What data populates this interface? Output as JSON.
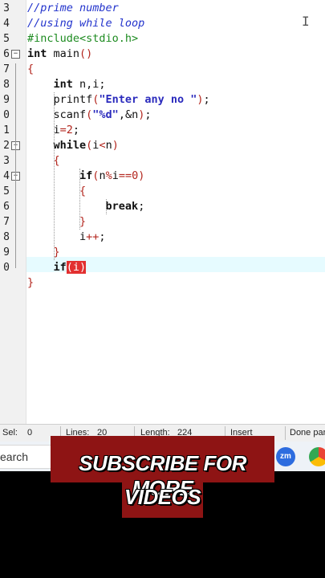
{
  "editor": {
    "line_numbers": [
      "3",
      "4",
      "5",
      "6",
      "7",
      "8",
      "9",
      "0",
      "1",
      "2",
      "3",
      "4",
      "5",
      "6",
      "7",
      "8",
      "9",
      "0"
    ],
    "lines": [
      [
        {
          "c": "cmt",
          "t": "//prime number"
        }
      ],
      [
        {
          "c": "cmt",
          "t": "//using while loop"
        }
      ],
      [
        {
          "c": "pre",
          "t": "#include<stdio.h>"
        }
      ],
      [
        {
          "c": "kw",
          "t": "int"
        },
        {
          "c": "nm",
          "t": " main"
        },
        {
          "c": "br",
          "t": "()"
        }
      ],
      [
        {
          "c": "br",
          "t": "{"
        }
      ],
      [
        {
          "c": "nm",
          "t": "    "
        },
        {
          "c": "kw",
          "t": "int"
        },
        {
          "c": "nm",
          "t": " n,i;"
        }
      ],
      [
        {
          "c": "nm",
          "t": "    printf"
        },
        {
          "c": "br",
          "t": "("
        },
        {
          "c": "str",
          "t": "\"Enter any no \""
        },
        {
          "c": "br",
          "t": ")"
        },
        {
          "c": "nm",
          "t": ";"
        }
      ],
      [
        {
          "c": "nm",
          "t": "    scanf"
        },
        {
          "c": "br",
          "t": "("
        },
        {
          "c": "str",
          "t": "\"%d\""
        },
        {
          "c": "nm",
          "t": ",&n"
        },
        {
          "c": "br",
          "t": ")"
        },
        {
          "c": "nm",
          "t": ";"
        }
      ],
      [
        {
          "c": "nm",
          "t": "    i"
        },
        {
          "c": "op",
          "t": "="
        },
        {
          "c": "num",
          "t": "2"
        },
        {
          "c": "nm",
          "t": ";"
        }
      ],
      [
        {
          "c": "nm",
          "t": "    "
        },
        {
          "c": "kw",
          "t": "while"
        },
        {
          "c": "br",
          "t": "("
        },
        {
          "c": "nm",
          "t": "i"
        },
        {
          "c": "op",
          "t": "<"
        },
        {
          "c": "nm",
          "t": "n"
        },
        {
          "c": "br",
          "t": ")"
        }
      ],
      [
        {
          "c": "nm",
          "t": "    "
        },
        {
          "c": "br",
          "t": "{"
        }
      ],
      [
        {
          "c": "nm",
          "t": "        "
        },
        {
          "c": "kw",
          "t": "if"
        },
        {
          "c": "br",
          "t": "("
        },
        {
          "c": "nm",
          "t": "n"
        },
        {
          "c": "op",
          "t": "%"
        },
        {
          "c": "nm",
          "t": "i"
        },
        {
          "c": "op",
          "t": "=="
        },
        {
          "c": "num",
          "t": "0"
        },
        {
          "c": "br",
          "t": ")"
        }
      ],
      [
        {
          "c": "nm",
          "t": "        "
        },
        {
          "c": "br",
          "t": "{"
        }
      ],
      [
        {
          "c": "nm",
          "t": "            "
        },
        {
          "c": "kw",
          "t": "break"
        },
        {
          "c": "nm",
          "t": ";"
        }
      ],
      [
        {
          "c": "nm",
          "t": "        "
        },
        {
          "c": "br",
          "t": "}"
        }
      ],
      [
        {
          "c": "nm",
          "t": "        i"
        },
        {
          "c": "op",
          "t": "++"
        },
        {
          "c": "nm",
          "t": ";"
        }
      ],
      [
        {
          "c": "nm",
          "t": "    "
        },
        {
          "c": "br",
          "t": "}"
        }
      ],
      [
        {
          "c": "nm",
          "t": "    "
        },
        {
          "c": "kw",
          "t": "if"
        },
        {
          "c": "hl",
          "t": "(i)"
        }
      ],
      [
        {
          "c": "br",
          "t": "}"
        }
      ]
    ]
  },
  "status": {
    "sel_label": "Sel:",
    "sel_value": "0",
    "lines_label": "Lines:",
    "lines_value": "20",
    "length_label": "Length:",
    "length_value": "224",
    "mode": "Insert",
    "state": "Done par"
  },
  "taskbar": {
    "search_text": "earch",
    "zm_label": "zm"
  },
  "banner": {
    "line1": "SUBSCRIBE FOR MORE",
    "line2": "VIDEOS"
  },
  "colors": {
    "banner_bg": "#8e1414",
    "current_line": "#e6fbff",
    "match_highlight": "#e23030"
  }
}
